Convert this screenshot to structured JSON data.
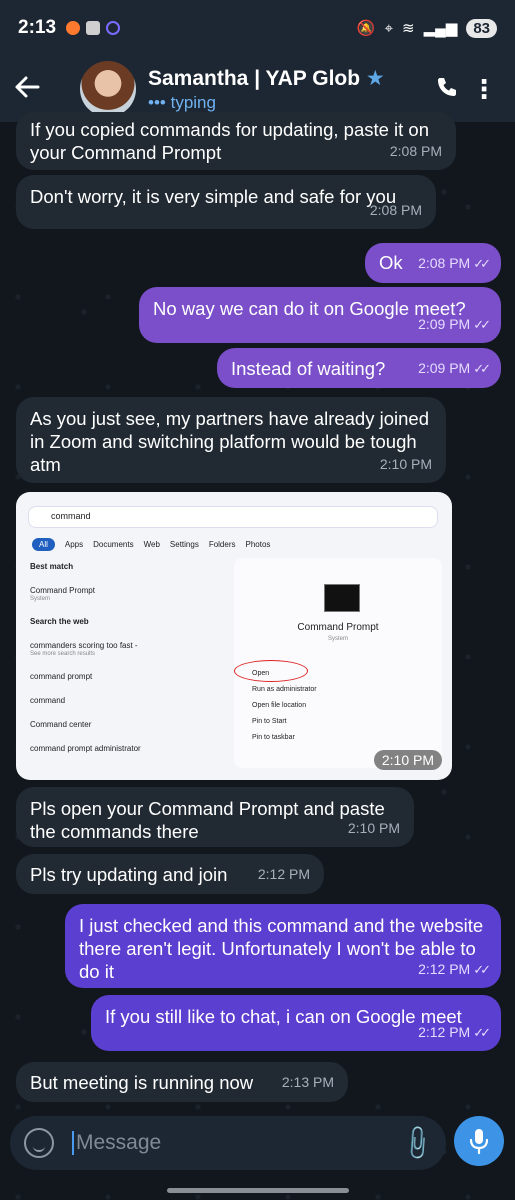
{
  "status": {
    "time": "2:13",
    "battery": "83"
  },
  "header": {
    "contact_name": "Samantha | YAP Glob",
    "star": "★",
    "status": "typing",
    "typing_dots": "•••"
  },
  "messages": [
    {
      "dir": "in",
      "text": "If you copied commands for updating, paste it on your Command Prompt",
      "time": "2:08 PM"
    },
    {
      "dir": "in",
      "text": "Don't worry, it is very simple and safe for you",
      "time": "2:08 PM"
    },
    {
      "dir": "out",
      "text": "Ok",
      "time": "2:08 PM"
    },
    {
      "dir": "out",
      "text": "No way we can do it on Google meet?",
      "time": "2:09 PM"
    },
    {
      "dir": "out",
      "text": "Instead of waiting?",
      "time": "2:09 PM"
    },
    {
      "dir": "in",
      "text": "As you just see, my partners have already joined in Zoom and switching platform would be tough atm",
      "time": "2:10 PM"
    },
    {
      "dir": "in",
      "text": "Pls open your Command Prompt and paste the commands there",
      "time": "2:10 PM"
    },
    {
      "dir": "in",
      "text": "Pls try updating and join",
      "time": "2:12 PM"
    },
    {
      "dir": "out",
      "text": "I just checked and this command and the website there aren't legit. Unfortunately I won't be able to do it",
      "time": "2:12 PM"
    },
    {
      "dir": "out",
      "text": "If you still like to chat, i can on Google meet",
      "time": "2:12 PM"
    },
    {
      "dir": "in",
      "text": "But meeting is running now",
      "time": "2:13 PM"
    }
  ],
  "image_message": {
    "time": "2:10 PM",
    "search_text": "command",
    "chips": [
      "All",
      "Apps",
      "Documents",
      "Web",
      "Settings",
      "Folders",
      "Photos"
    ],
    "left_items": [
      "Best match",
      "Command Prompt",
      "System",
      "Search the web",
      "commanders scoring too fast -",
      "See more search results",
      "command prompt",
      "command",
      "Command center",
      "command prompt administrator"
    ],
    "app_title": "Command Prompt",
    "app_subtitle": "System",
    "actions": [
      "Open",
      "Run as administrator",
      "Open file location",
      "Pin to Start",
      "Pin to taskbar"
    ]
  },
  "composer": {
    "placeholder": "Message"
  }
}
